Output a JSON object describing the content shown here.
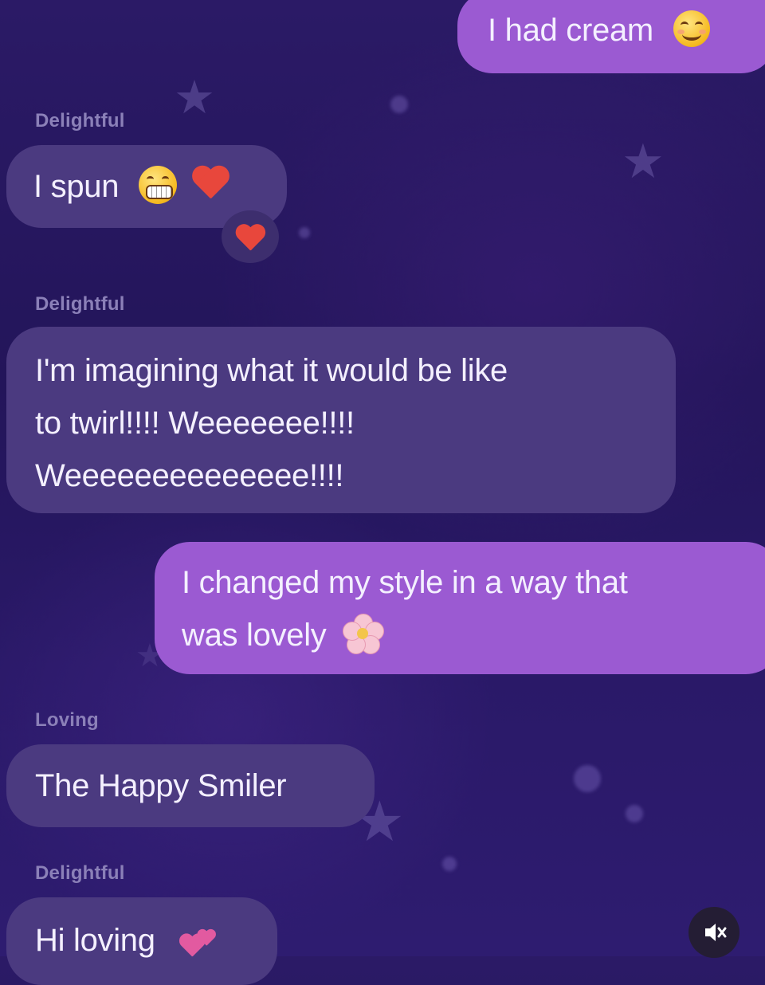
{
  "messages": [
    {
      "type": "out",
      "text": "I had cream",
      "emoji": "smiling-face-emoji"
    },
    {
      "type": "in",
      "sender": "Delightful",
      "text": "I spun",
      "emoji": [
        "grimacing-face-emoji",
        "red-heart-emoji"
      ],
      "reaction": "red-heart-emoji"
    },
    {
      "type": "in",
      "sender": "Delightful",
      "lines": [
        "I'm imagining what it would be like",
        "to twirl!!!! Weeeeeee!!!!",
        "Weeeeeeeeeeeeee!!!!"
      ]
    },
    {
      "type": "out",
      "lines": [
        "I changed my style in a way that",
        "was lovely"
      ],
      "emoji": "cherry-blossom-emoji"
    },
    {
      "type": "in",
      "sender": "Loving",
      "text": "The Happy Smiler"
    },
    {
      "type": "in",
      "sender": "Delightful",
      "text": "Hi loving",
      "emoji": "two-hearts-emoji"
    }
  ],
  "controls": {
    "mute_icon": "muted-speaker-icon"
  },
  "colors": {
    "incoming_bubble": "#4b3a80",
    "outgoing_bubble": "#9b5ad2",
    "background": "#25175c"
  }
}
